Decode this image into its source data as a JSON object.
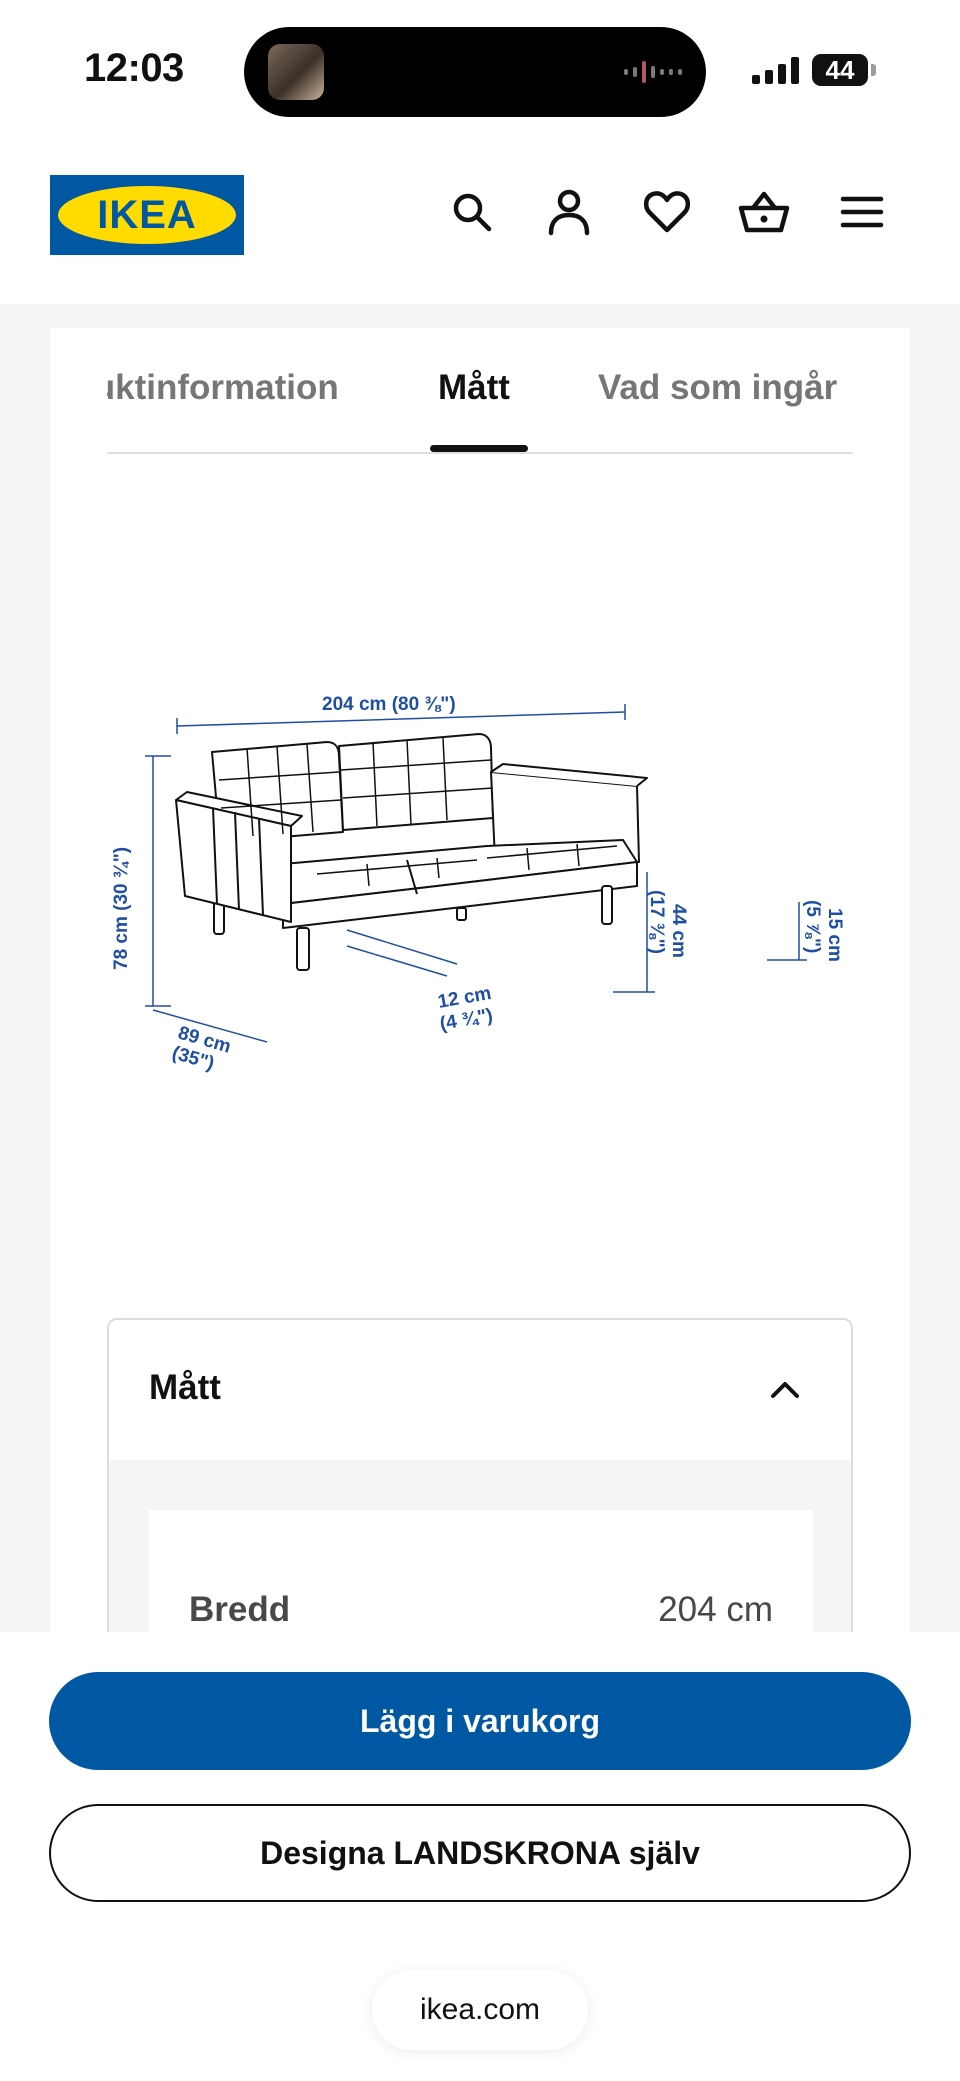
{
  "status_bar": {
    "time": "12:03",
    "battery": "44"
  },
  "header": {
    "logo_text": "IKEA",
    "brand_blue": "#0058a3",
    "brand_yellow": "#ffdb00",
    "icons": [
      "search-icon",
      "account-icon",
      "heart-icon",
      "basket-icon",
      "menu-icon"
    ]
  },
  "tabs": [
    {
      "label": "Produktinformation",
      "active": false
    },
    {
      "label": "Mått",
      "active": true
    },
    {
      "label": "Vad som ingår",
      "active": false
    }
  ],
  "drawing": {
    "width": "204 cm (80 ⅜\")",
    "height": "78 cm (30 ¾\")",
    "depth_cm": "89 cm",
    "depth_in": "(35\")",
    "arm_cm": "12 cm",
    "arm_in": "(4 ¾\")",
    "seat_height_cm": "44 cm",
    "seat_height_in": "(17 ⅜\")",
    "leg_cm": "15 cm",
    "leg_in": "(5 ⅞\")",
    "dimension_color": "#1f4fa3"
  },
  "accordion": {
    "title": "Mått",
    "rows": [
      {
        "label": "Bredd",
        "value": "204 cm"
      }
    ]
  },
  "actions": {
    "add_to_cart": "Lägg i varukorg",
    "design_yourself": "Designa LANDSKRONA själv"
  },
  "browser": {
    "url": "ikea.com"
  }
}
